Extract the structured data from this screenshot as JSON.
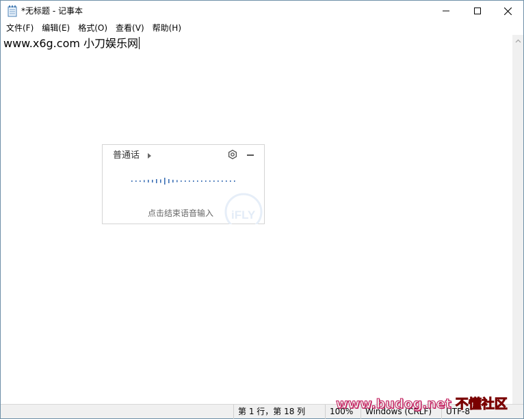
{
  "window": {
    "title": "*无标题 - 记事本"
  },
  "menu": {
    "items": [
      {
        "label": "文件(F)"
      },
      {
        "label": "编辑(E)"
      },
      {
        "label": "格式(O)"
      },
      {
        "label": "查看(V)"
      },
      {
        "label": "帮助(H)"
      }
    ]
  },
  "editor": {
    "content": "www.x6g.com 小刀娱乐网"
  },
  "voice_input": {
    "language": "普通话",
    "hint": "点击结束语音输入",
    "logo_text": "iFLY"
  },
  "statusbar": {
    "position": "第 1 行，第 18 列",
    "zoom": "100%",
    "line_ending": "Windows (CRLF)",
    "encoding": "UTF-8"
  },
  "watermark": {
    "url": "www.budog.net",
    "name": "不懂社区"
  },
  "colors": {
    "window_border": "#6d8fa8",
    "statusbar_bg": "#f0f0f0",
    "voice_accent": "#3b6fb5"
  },
  "icons": {
    "app": "notepad-icon",
    "minimize": "minimize-icon",
    "maximize": "maximize-icon",
    "close": "close-icon",
    "scroll_up": "chevron-up-icon",
    "voice_settings": "settings-icon",
    "voice_minimize": "minus-icon"
  }
}
